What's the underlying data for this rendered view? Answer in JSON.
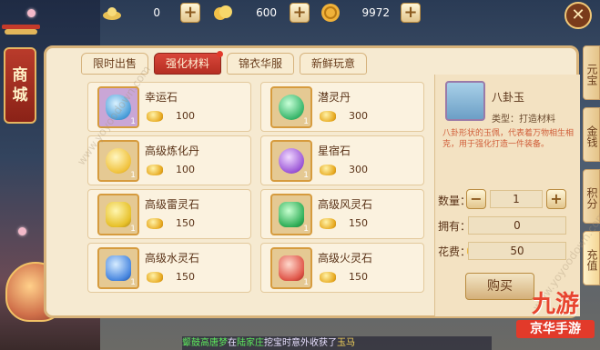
{
  "currencies": [
    {
      "icon": "silver-ingot-icon",
      "value": "0"
    },
    {
      "icon": "gold-coins-icon",
      "value": "600"
    },
    {
      "icon": "copper-coin-icon",
      "value": "9972"
    }
  ],
  "shop_sign": [
    "商",
    "城"
  ],
  "tabs": [
    {
      "label": "限时出售",
      "active": false
    },
    {
      "label": "强化材料",
      "active": true
    },
    {
      "label": "锦衣华服",
      "active": false
    },
    {
      "label": "新鲜玩意",
      "active": false
    }
  ],
  "items": [
    {
      "name": "幸运石",
      "price": "100",
      "icon": "blue-crystal-icon",
      "qty": "1"
    },
    {
      "name": "潜灵丹",
      "price": "300",
      "icon": "green-pill-icon",
      "qty": "1"
    },
    {
      "name": "高级炼化丹",
      "price": "100",
      "icon": "yellow-pill-icon",
      "qty": "1"
    },
    {
      "name": "星宿石",
      "price": "300",
      "icon": "purple-star-stone-icon",
      "qty": "1"
    },
    {
      "name": "高级雷灵石",
      "price": "150",
      "icon": "yellow-spirit-stone-icon",
      "qty": "1"
    },
    {
      "name": "高级风灵石",
      "price": "150",
      "icon": "green-spirit-stone-icon",
      "qty": "1"
    },
    {
      "name": "高级水灵石",
      "price": "150",
      "icon": "blue-spirit-stone-icon",
      "qty": "1"
    },
    {
      "name": "高级火灵石",
      "price": "150",
      "icon": "red-spirit-stone-icon",
      "qty": "1"
    }
  ],
  "detail": {
    "title": "八卦玉",
    "type": "类型：打造材料",
    "description": "八卦形状的玉佩，代表着万物相生相克，用于强化打造一件装备。",
    "qty_label": "数量：",
    "qty_value": "1",
    "owned_label": "拥有：",
    "owned_value": "0",
    "cost_label": "花费：",
    "cost_value": "50",
    "buy_label": "购买"
  },
  "side_tabs": [
    "元宝",
    "金钱",
    "积分",
    "充值"
  ],
  "ticker": {
    "player": "颦鼓高唐梦",
    "mid1": "在",
    "place": "陆家庄",
    "mid2": "挖宝时意外收获了",
    "reward": "玉马"
  },
  "logo": {
    "top": "九游",
    "bottom": "京华手游"
  },
  "watermark": "www.yoyoodown.com",
  "colors": {
    "accent_red": "#d9463a",
    "panel_bg": "#f6ead1",
    "border_gold": "#d8b37a"
  }
}
